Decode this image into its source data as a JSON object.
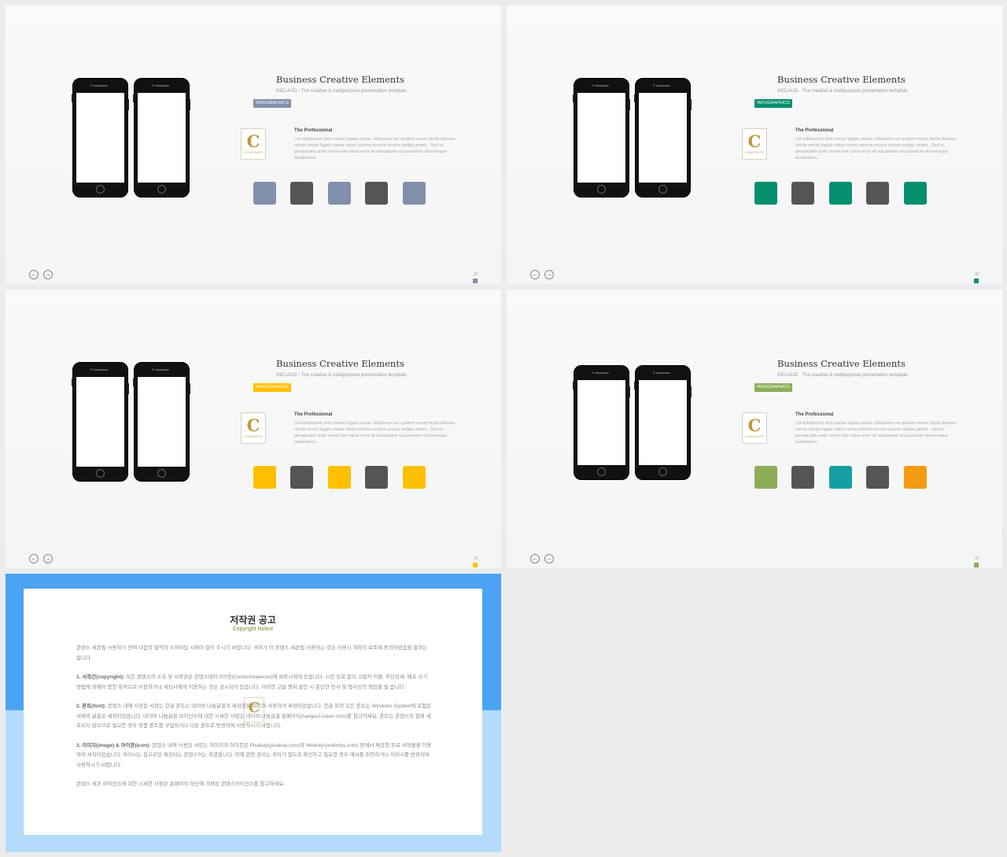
{
  "slides": [
    {
      "title": "Business Creative Elements",
      "subtitle": "INCLAUD - The creative & multipurpose presentation template",
      "tag": "INFOGRAPHICS",
      "accent": "#8190ab",
      "logo": {
        "letter": "C",
        "word": "CONTENTS"
      },
      "pro_title": "The Professional",
      "pro_text": "Lid estlaborum dolo rumes fugats untras. Etharums ser quidem rerum facilis dolores nemis omnis fugats vitaes nemo minima rerums unsers sadips amets.. Sed ut perspiciatis unde omnis iste natus error sit voluptatem accusantium doloremque laudantium.",
      "squares": [
        "#8190ab",
        "#555555",
        "#8190ab",
        "#555555",
        "#8190ab"
      ],
      "prev_icon": "←",
      "next_icon": "→",
      "page": "37"
    },
    {
      "title": "Business Creative Elements",
      "subtitle": "INCLAUD - The creative & multipurpose presentation template",
      "tag": "INFOGRAPHICS",
      "accent": "#068f6f",
      "logo": {
        "letter": "C",
        "word": "CONTENTS"
      },
      "pro_title": "The Professional",
      "pro_text": "Lid estlaborum dolo rumes fugats untras. Etharums ser quidem rerum facilis dolores nemis omnis fugats vitaes nemo minima rerums unsers sadips amets.. Sed ut perspiciatis unde omnis iste natus error sit voluptatem accusantium doloremque laudantium.",
      "squares": [
        "#068f6f",
        "#555555",
        "#068f6f",
        "#555555",
        "#068f6f"
      ],
      "prev_icon": "←",
      "next_icon": "→",
      "page": "37"
    },
    {
      "title": "Business Creative Elements",
      "subtitle": "INCLAUD - The creative & multipurpose presentation template",
      "tag": "INFOGRAPHICS",
      "accent": "#ffc000",
      "logo": {
        "letter": "C",
        "word": "CONTENTS"
      },
      "pro_title": "The Professional",
      "pro_text": "Lid estlaborum dolo rumes fugats untras. Etharums ser quidem rerum facilis dolores nemis omnis fugats vitaes nemo minima rerums unsers sadips amets.. Sed ut perspiciatis unde omnis iste natus error sit voluptatem accusantium doloremque laudantium.",
      "squares": [
        "#ffc000",
        "#555555",
        "#ffc000",
        "#555555",
        "#ffc000"
      ],
      "prev_icon": "←",
      "next_icon": "→",
      "page": "37"
    },
    {
      "title": "Business Creative Elements",
      "subtitle": "INCLAUD - The creative & multipurpose presentation template",
      "tag": "INFOGRAPHICS",
      "accent": "#8cad57",
      "logo": {
        "letter": "C",
        "word": "CONTENTS"
      },
      "pro_title": "The Professional",
      "pro_text": "Lid estlaborum dolo rumes fugats untras. Etharums ser quidem rerum facilis dolores nemis omnis fugats vitaes nemo minima rerums unsers sadips amets.. Sed ut perspiciatis unde omnis iste natus error sit voluptatem accusantium doloremque laudantium.",
      "squares": [
        "#8cad57",
        "#555555",
        "#159fa3",
        "#555555",
        "#f39b12"
      ],
      "prev_icon": "←",
      "next_icon": "→",
      "page": "37"
    }
  ],
  "notice": {
    "title": "저작권 공고",
    "subtitle": "Copyright Notice",
    "logo_letter": "C",
    "intro": "콘텐스 세콘핍 사용하기 전에 다음의 협약의 소하비입 시에이 말어 주시기 바랍니다. 귀하가 이 콘텐스 세콘핍 사용하는 것은 사용시 개와의 보조에 동의하셨음을 말하는합니다.",
    "p1_label": "1. 서작건(copyright):",
    "p1_text": " 모든 콘텐스의 소유 및 서작권은 콘텐스테이크아웃(Contentstakeout)에 세작시에게 있습니다. 시전 승복 없이 고발적 이불, 무단전세, 배포 사기 방법에 외에이 명한 목적으로 이용하거나 세상시에게 이용하는 것은 금시되어 있습니다. 이러한 고발 행위 발인 시 준인한 민사 및 형사상의 책임을 될 습니다.",
    "p2_label": "2. 폰트(font):",
    "p2_text": " 콘텐스 내에 사용된 서양는 한글 폰트는 네이버 나눔글꼴의 세작권을 따르며 사용하여 세작되었습니다. 한글 외의 모든 폰트는 Windows System에 포함된 서체와 글꼴로 세작되었습니다. 네이버 나눔글꼴 라이선스에 대한 시세한 사항은 네이버 나눔글꼴 홈페이지(hangeul.naver.com)를 참고하세요. 폰트는 콘텐스의 협에 세포되지 않으므로 필요한 경우 정품 폰트를 구입하거나 다른 폰트로 변경하여 사용하시기 바랍니다.",
    "p3_label": "3. 이미지(image) & 아이콘(icon):",
    "p3_text": " 콘텐스 내에 사용된 서양는 이미지와 아이콘은 Pixabay(pixabay.com)와 Webolys(webolys.com) 등에서 제공한 무료 서작물을 이용하여 세작되었습니다. 아이시는 참고로만 제공되는 콘텐스이는 무관합니다. 이에 관한 권리는 귀하가 별도로 확인하고 필요한 경우 에서를 취득하거나 이미시를 변경하여 사용하시기 바랍니다.",
    "closing": "콘텐스 세콘 라이선스에 대한 시세한 사항은 홈페이지 하단에 기재된 콘텐스라이선스를 참고하세요."
  }
}
